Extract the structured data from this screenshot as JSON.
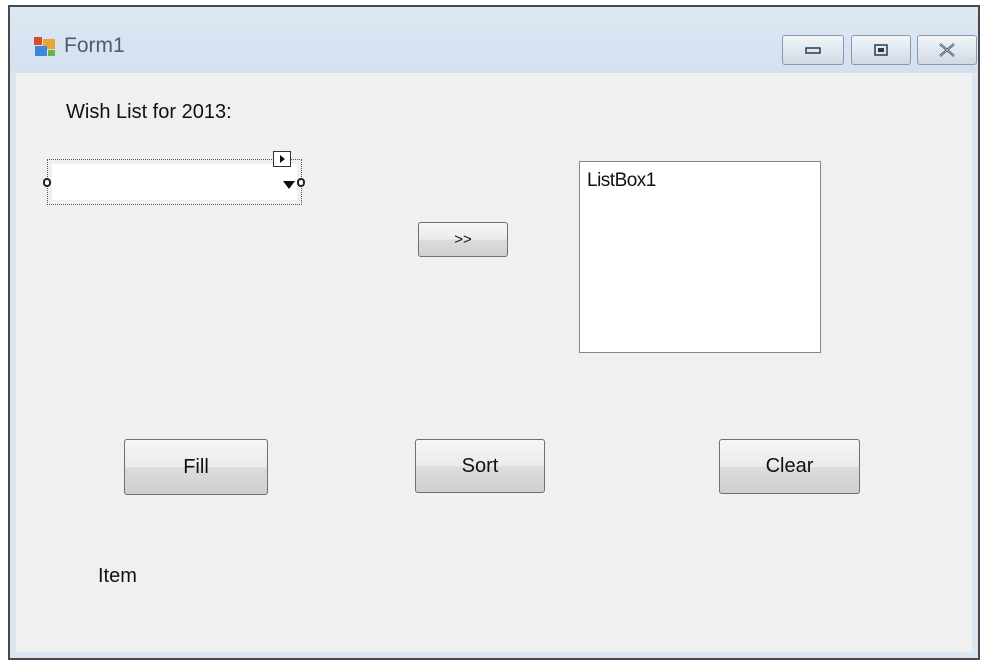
{
  "window": {
    "title": "Form1",
    "controls": {
      "minimize_icon": "minimize-icon",
      "maximize_icon": "maximize-icon",
      "close_icon": "close-icon"
    }
  },
  "form": {
    "heading": "Wish List for 2013:",
    "combobox_value": "",
    "move_button_label": ">>",
    "listbox_label": "ListBox1",
    "fill_button_label": "Fill",
    "sort_button_label": "Sort",
    "clear_button_label": "Clear",
    "item_label": "Item"
  },
  "colors": {
    "client_background": "#f0f0f0",
    "titlebar": "#d9e4f1",
    "button_border": "#707070"
  }
}
